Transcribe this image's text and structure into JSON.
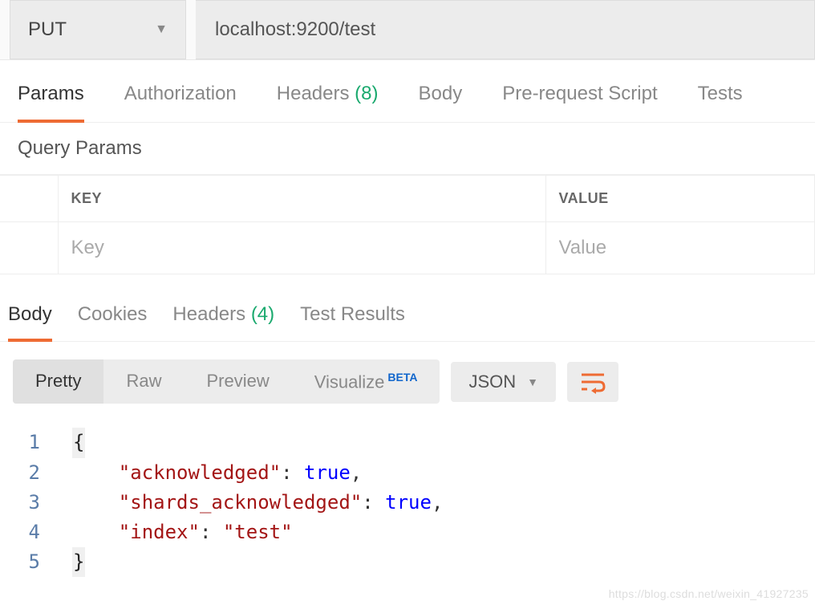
{
  "request": {
    "method": "PUT",
    "url": "localhost:9200/test"
  },
  "req_tabs": {
    "params": "Params",
    "authorization": "Authorization",
    "headers_label": "Headers",
    "headers_count": "(8)",
    "body": "Body",
    "prerequest": "Pre-request Script",
    "tests": "Tests"
  },
  "query_params": {
    "title": "Query Params",
    "key_header": "KEY",
    "value_header": "VALUE",
    "key_placeholder": "Key",
    "value_placeholder": "Value"
  },
  "resp_tabs": {
    "body": "Body",
    "cookies": "Cookies",
    "headers_label": "Headers",
    "headers_count": "(4)",
    "test_results": "Test Results"
  },
  "body_toolbar": {
    "pretty": "Pretty",
    "raw": "Raw",
    "preview": "Preview",
    "visualize": "Visualize",
    "beta": "BETA",
    "format": "JSON"
  },
  "response_json": {
    "l1": "{",
    "l2_key": "\"acknowledged\"",
    "l2_val": "true",
    "l3_key": "\"shards_acknowledged\"",
    "l3_val": "true",
    "l4_key": "\"index\"",
    "l4_val": "\"test\"",
    "l5": "}"
  },
  "watermark": "https://blog.csdn.net/weixin_41927235"
}
